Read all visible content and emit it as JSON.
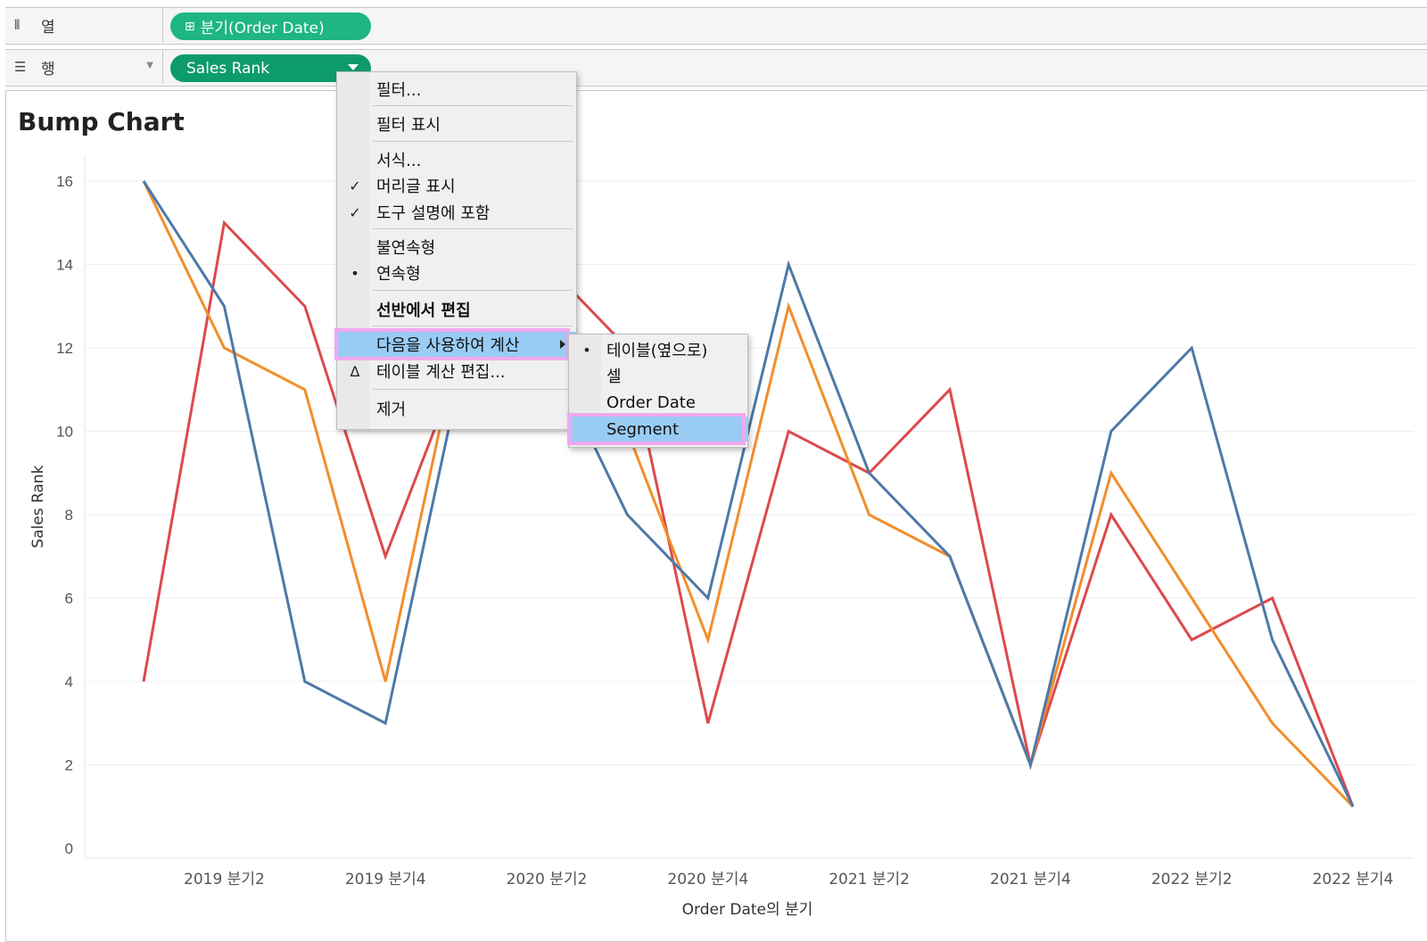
{
  "shelves": {
    "columns": {
      "label": "열",
      "icon": "columns-icon",
      "pill": "분기(Order Date)",
      "pill_prefix": "⊞"
    },
    "rows": {
      "label": "행",
      "icon": "rows-icon",
      "pill": "Sales Rank"
    }
  },
  "chart_title": "Bump Chart",
  "context_menu": {
    "items": [
      {
        "label": "필터...",
        "mark": ""
      },
      {
        "label": "필터 표시",
        "mark": ""
      },
      {
        "label": "서식...",
        "mark": ""
      },
      {
        "label": "머리글 표시",
        "mark": "✓"
      },
      {
        "label": "도구 설명에 포함",
        "mark": "✓"
      },
      {
        "label": "불연속형",
        "mark": ""
      },
      {
        "label": "연속형",
        "mark": "•"
      },
      {
        "label": "선반에서 편집",
        "mark": ""
      },
      {
        "label": "다음을 사용하여 계산",
        "mark": ""
      },
      {
        "label": "테이블 계산 편집...",
        "mark": "Δ"
      },
      {
        "label": "제거",
        "mark": ""
      }
    ],
    "highlighted": "다음을 사용하여 계산"
  },
  "submenu": {
    "items": [
      {
        "label": "테이블(옆으로)",
        "mark": "•"
      },
      {
        "label": "셀",
        "mark": ""
      },
      {
        "label": "Order Date",
        "mark": ""
      },
      {
        "label": "Segment",
        "mark": ""
      }
    ],
    "highlighted": "Segment"
  },
  "chart_data": {
    "type": "line",
    "title": "Bump Chart",
    "xlabel": "Order Date의 분기",
    "ylabel": "Sales Rank",
    "x": [
      "2019 분기1",
      "2019 분기2",
      "2019 분기3",
      "2019 분기4",
      "2020 분기1",
      "2020 분기2",
      "2020 분기3",
      "2020 분기4",
      "2021 분기1",
      "2021 분기2",
      "2021 분기3",
      "2021 분기4",
      "2022 분기1",
      "2022 분기2",
      "2022 분기3",
      "2022 분기4"
    ],
    "xtick_labels": [
      "2019 분기2",
      "2019 분기4",
      "2020 분기2",
      "2020 분기4",
      "2021 분기2",
      "2021 분기4",
      "2022 분기2",
      "2022 분기4"
    ],
    "yticks": [
      0,
      2,
      4,
      6,
      8,
      10,
      12,
      14,
      16
    ],
    "ylim": [
      0,
      16.5
    ],
    "grid": true,
    "series": [
      {
        "color": "#dc4a4d",
        "values": [
          4,
          15,
          13,
          7,
          12,
          14,
          12,
          3,
          10,
          9,
          11,
          2,
          8,
          5,
          6,
          1
        ]
      },
      {
        "color": "#f28e2b",
        "values": [
          16,
          12,
          11,
          4,
          13,
          13,
          10,
          5,
          13,
          8,
          7,
          2,
          9,
          6,
          3,
          1
        ]
      },
      {
        "color": "#4e79a7",
        "values": [
          16,
          13,
          4,
          3,
          12,
          12,
          8,
          6,
          14,
          9,
          7,
          2,
          10,
          12,
          5,
          1
        ]
      }
    ]
  }
}
